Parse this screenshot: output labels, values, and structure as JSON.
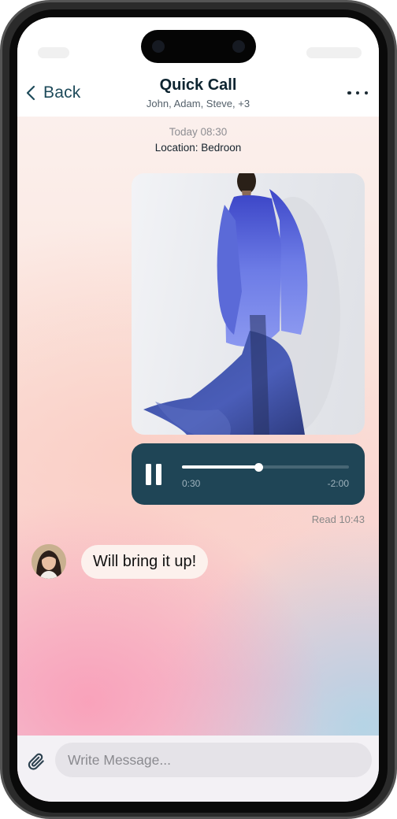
{
  "header": {
    "back_label": "Back",
    "title": "Quick Call",
    "subtitle": "John, Adam, Steve, +3"
  },
  "chat": {
    "timestamp": "Today 08:30",
    "location": "Location: Bedroon",
    "audio": {
      "progress": 0.46,
      "elapsed": "0:30",
      "remaining": "-2:00"
    },
    "read_status": "Read 10:43",
    "incoming_message": "Will bring it up!"
  },
  "composer": {
    "placeholder": "Write Message..."
  },
  "icons": {
    "back": "chevron-left-icon",
    "more": "more-horizontal-icon",
    "play_state": "pause-icon",
    "attach": "paperclip-icon"
  },
  "colors": {
    "accent": "#1f4556",
    "title": "#0d2430",
    "back": "#1e4a5a",
    "coat": "#5866d8"
  }
}
